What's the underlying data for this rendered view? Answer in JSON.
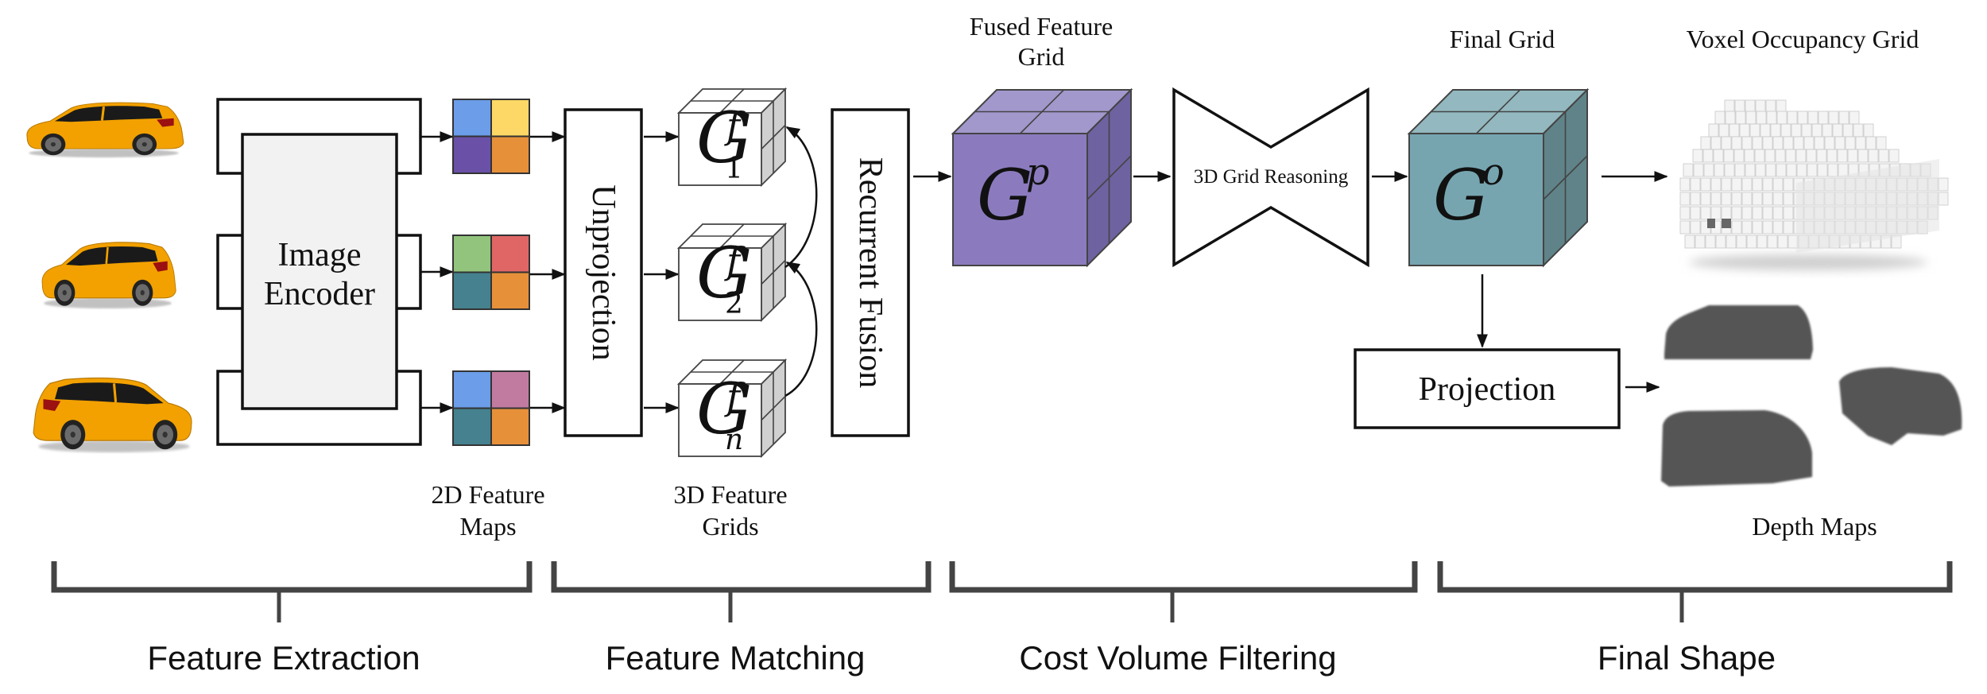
{
  "diagram": {
    "top_labels": {
      "fused_feature_grid": [
        "Fused Feature",
        "Grid"
      ],
      "final_grid": "Final Grid",
      "voxel_occupancy_grid": "Voxel Occupancy Grid"
    },
    "inputs": {
      "views": [
        "car-view-1",
        "car-view-2",
        "car-view-3"
      ],
      "car_colors": {
        "body": "#F2A100",
        "window": "#1a1a1a",
        "taillight": "#9B1010",
        "wheel": "#6b6b6b"
      }
    },
    "blocks": {
      "image_encoder": [
        "Image",
        "Encoder"
      ],
      "unprojection": "Unprojection",
      "recurrent_fusion": "Recurrent Fusion",
      "grid_reasoning": "3D Grid Reasoning",
      "projection": "Projection"
    },
    "feature_maps": [
      {
        "colors": [
          "#6B9DE8",
          "#FDD866",
          "#6A50A7",
          "#E6903A"
        ]
      },
      {
        "colors": [
          "#93C47D",
          "#E06666",
          "#45818E",
          "#E6903A"
        ]
      },
      {
        "colors": [
          "#6B9DE8",
          "#C27BA0",
          "#45818E",
          "#E6903A"
        ]
      }
    ],
    "feature_grids": [
      {
        "symbol": "G",
        "sup": "f",
        "sub": "1"
      },
      {
        "symbol": "G",
        "sup": "f",
        "sub": "2"
      },
      {
        "symbol": "G",
        "sup": "f",
        "sub": "n"
      }
    ],
    "fused_grid": {
      "symbol": "G",
      "sup": "p",
      "colors": {
        "front": "#8B7BBE",
        "top": "#A398CC",
        "side": "#6F62A0"
      }
    },
    "final_grid": {
      "symbol": "G",
      "sup": "o",
      "colors": {
        "front": "#76A5B0",
        "top": "#93B8BF",
        "side": "#5F8388"
      }
    },
    "small_grid_colors": {
      "front": "#ffffff",
      "top": "#ffffff",
      "side": "#D0D0D0"
    },
    "mid_labels": {
      "feature_maps_2d": [
        "2D Feature",
        "Maps"
      ],
      "feature_grids_3d": [
        "3D Feature",
        "Grids"
      ],
      "depth_maps": "Depth Maps"
    },
    "stages": [
      {
        "label": "Feature Extraction"
      },
      {
        "label": "Feature Matching"
      },
      {
        "label": "Cost Volume Filtering"
      },
      {
        "label": "Final Shape"
      }
    ],
    "colors": {
      "encoder_fill": "#F2F2F2",
      "bracket": "#444444",
      "depth_map": "#555555",
      "voxel": "#F4F4F4"
    }
  }
}
